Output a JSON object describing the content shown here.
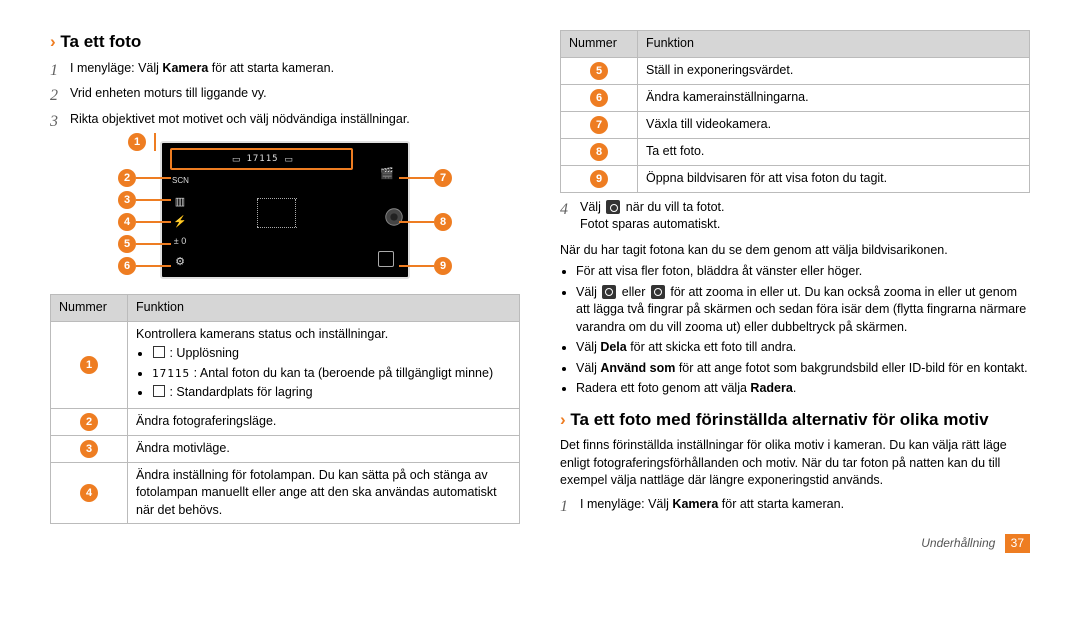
{
  "heading_left": "Ta ett foto",
  "steps_left": [
    {
      "n": "1",
      "text_pre": "I menyläge: Välj ",
      "bold": "Kamera",
      "text_post": " för att starta kameran."
    },
    {
      "n": "2",
      "text_pre": "Vrid enheten moturs till liggande vy.",
      "bold": "",
      "text_post": ""
    },
    {
      "n": "3",
      "text_pre": "Rikta objektivet mot motivet och välj nödvändiga inställningar.",
      "bold": "",
      "text_post": ""
    }
  ],
  "table_left_headers": {
    "num": "Nummer",
    "func": "Funktion"
  },
  "table_left": [
    {
      "badge": "1",
      "lead": "Kontrollera kamerans status och inställningar.",
      "bullets": [
        {
          "icon": "res",
          "text": " : Upplösning"
        },
        {
          "icon": "count",
          "text": " : Antal foton du kan ta (beroende på tillgängligt minne)"
        },
        {
          "icon": "store",
          "text": " : Standardplats för lagring"
        }
      ]
    },
    {
      "badge": "2",
      "text": "Ändra fotograferingsläge."
    },
    {
      "badge": "3",
      "text": "Ändra motivläge."
    },
    {
      "badge": "4",
      "text": "Ändra inställning för fotolampan. Du kan sätta på och stänga av fotolampan manuellt eller ange att den ska användas automatiskt när det behövs."
    }
  ],
  "table_right_headers": {
    "num": "Nummer",
    "func": "Funktion"
  },
  "table_right": [
    {
      "badge": "5",
      "text": "Ställ in exponeringsvärdet."
    },
    {
      "badge": "6",
      "text": "Ändra kamerainställningarna."
    },
    {
      "badge": "7",
      "text": "Växla till videokamera."
    },
    {
      "badge": "8",
      "text": "Ta ett foto."
    },
    {
      "badge": "9",
      "text": "Öppna bildvisaren för att visa foton du tagit."
    }
  ],
  "step4": {
    "n": "4",
    "pre": "Välj ",
    "post": " när du vill ta fotot."
  },
  "step4_sub": "Fotot sparas automatiskt.",
  "para_after_photo": "När du har tagit fotona kan du se dem genom att välja bildvisarikonen.",
  "tips": [
    {
      "text": "För att visa fler foton, bläddra åt vänster eller höger."
    },
    {
      "pre": "Välj ",
      "mid": " eller ",
      "post": " för att zooma in eller ut. Du kan också zooma in eller ut genom att lägga två fingrar på skärmen och sedan föra isär dem (flytta fingrarna närmare varandra om du vill zooma ut) eller dubbeltryck på skärmen."
    },
    {
      "pre": "Välj ",
      "bold": "Dela",
      "post": " för att skicka ett foto till andra."
    },
    {
      "pre": "Välj ",
      "bold": "Använd som",
      "post": " för att ange fotot som bakgrundsbild eller ID-bild för en kontakt."
    },
    {
      "pre": "Radera ett foto genom att välja ",
      "bold": "Radera",
      "post": "."
    }
  ],
  "heading_right2": "Ta ett foto med förinställda alternativ för olika motiv",
  "para_right2": "Det finns förinställda inställningar för olika motiv i kameran. Du kan välja rätt läge enligt fotograferingsförhållanden och motiv. När du tar foton på natten kan du till exempel välja nattläge där längre exponeringstid används.",
  "steps_right2": [
    {
      "n": "1",
      "text_pre": "I menyläge: Välj ",
      "bold": "Kamera",
      "text_post": " för att starta kameran."
    }
  ],
  "count_glyph": "17115",
  "footer": {
    "section": "Underhållning",
    "page": "37"
  }
}
